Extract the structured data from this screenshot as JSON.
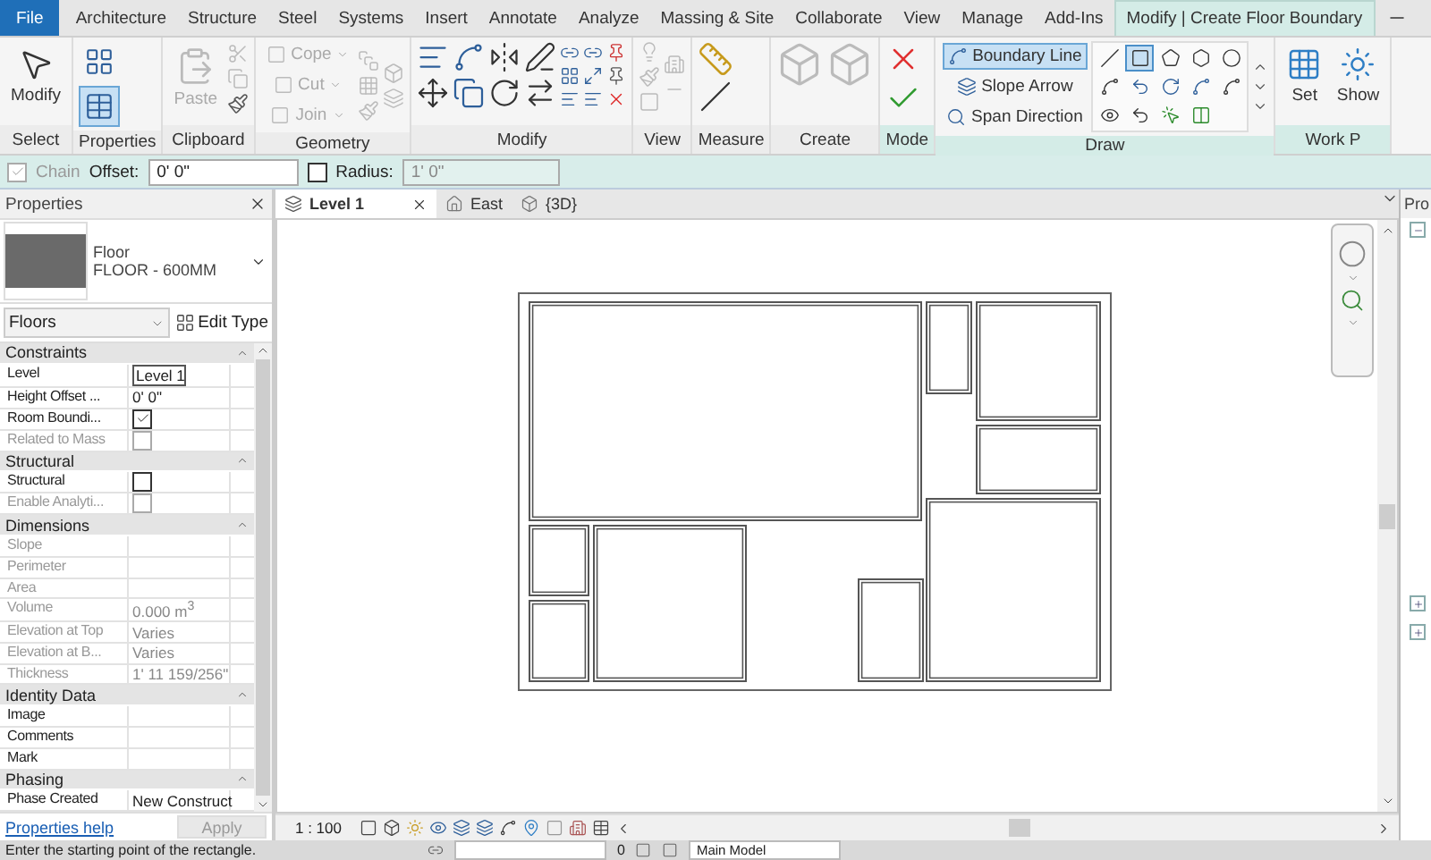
{
  "ribbon": {
    "tabs": [
      {
        "label": "File",
        "kind": "file",
        "selected": false
      },
      {
        "label": "Architecture",
        "kind": "tab",
        "selected": false
      },
      {
        "label": "Structure",
        "kind": "tab",
        "selected": false
      },
      {
        "label": "Steel",
        "kind": "tab",
        "selected": false
      },
      {
        "label": "Systems",
        "kind": "tab",
        "selected": false
      },
      {
        "label": "Insert",
        "kind": "tab",
        "selected": false
      },
      {
        "label": "Annotate",
        "kind": "tab",
        "selected": false
      },
      {
        "label": "Analyze",
        "kind": "tab",
        "selected": false
      },
      {
        "label": "Massing & Site",
        "kind": "tab",
        "selected": false
      },
      {
        "label": "Collaborate",
        "kind": "tab",
        "selected": false
      },
      {
        "label": "View",
        "kind": "tab",
        "selected": false
      },
      {
        "label": "Manage",
        "kind": "tab",
        "selected": false
      },
      {
        "label": "Add-Ins",
        "kind": "tab",
        "selected": false
      },
      {
        "label": "Modify | Create Floor Boundary",
        "kind": "context",
        "selected": true
      }
    ],
    "panels": [
      {
        "kind": "select",
        "label": "Select",
        "contextual": false,
        "tools": [
          {
            "label": "Modify",
            "disabled": false
          }
        ]
      },
      {
        "kind": "properties",
        "label": "Properties",
        "contextual": false,
        "tools": [
          {
            "selected": false
          },
          {
            "selected": true
          }
        ]
      },
      {
        "kind": "clipboard",
        "label": "Clipboard",
        "contextual": false,
        "tools": [
          {
            "label": "Paste",
            "disabled": true
          }
        ]
      },
      {
        "kind": "geometry",
        "label": "Geometry",
        "contextual": false,
        "tools": [
          {
            "label": "Cope",
            "disabled": true
          },
          {
            "label": "Cut",
            "disabled": true
          },
          {
            "label": "Join",
            "disabled": true
          }
        ]
      },
      {
        "kind": "modify",
        "label": "Modify",
        "contextual": false
      },
      {
        "kind": "view",
        "label": "View",
        "contextual": false
      },
      {
        "kind": "measure",
        "label": "Measure",
        "contextual": false
      },
      {
        "kind": "create",
        "label": "Create",
        "contextual": false
      },
      {
        "kind": "mode",
        "label": "Mode",
        "contextual": true
      },
      {
        "kind": "draw",
        "label": "Draw",
        "contextual": true,
        "tools": [
          {
            "label": "Boundary Line",
            "selected": true
          },
          {
            "label": "Slope Arrow",
            "selected": false
          },
          {
            "label": "Span Direction",
            "selected": false
          }
        ],
        "shapes": [
          {
            "kind": "line",
            "selected": false
          },
          {
            "kind": "rectangle",
            "selected": true
          },
          {
            "kind": "polygon",
            "selected": false
          },
          {
            "kind": "circumscribed",
            "selected": false
          },
          {
            "kind": "circle",
            "selected": false
          },
          {
            "kind": "arc3",
            "selected": false
          },
          {
            "kind": "arc",
            "selected": false
          },
          {
            "kind": "tangent",
            "selected": false
          },
          {
            "kind": "fillet",
            "selected": false
          },
          {
            "kind": "spline",
            "selected": false
          },
          {
            "kind": "ellipse",
            "selected": false
          },
          {
            "kind": "partial",
            "selected": false
          },
          {
            "kind": "pick",
            "selected": false
          },
          {
            "kind": "pickwall",
            "selected": false
          }
        ]
      },
      {
        "kind": "workplane",
        "label": "Work P",
        "contextual": true,
        "tools": [
          {
            "label": "Set",
            "disabled": false
          },
          {
            "label": "Show",
            "disabled": false
          }
        ]
      }
    ]
  },
  "options_bar": {
    "chain": {
      "label": "Chain",
      "checked": true,
      "disabled": true
    },
    "offset": {
      "label": "Offset:",
      "value": "0'  0\""
    },
    "radius": {
      "label": "Radius:",
      "checked": false,
      "disabled": true,
      "value": "1'  0\""
    }
  },
  "properties": {
    "title": "Properties",
    "type_family": "Floor",
    "type_name": "FLOOR - 600MM",
    "category": "Floors",
    "edit_type": "Edit Type",
    "sections": [
      {
        "title": "Constraints",
        "rows": [
          {
            "label": "Level",
            "kind": "field",
            "value": "Level 1",
            "disabled": false
          },
          {
            "label": "Height Offset ...",
            "kind": "text",
            "value": "0'  0\"",
            "disabled": false
          },
          {
            "label": "Room Boundi...",
            "kind": "checkbox",
            "checked": true,
            "disabled": false
          },
          {
            "label": "Related to Mass",
            "kind": "checkbox",
            "checked": false,
            "disabled": true
          }
        ]
      },
      {
        "title": "Structural",
        "rows": [
          {
            "label": "Structural",
            "kind": "checkbox",
            "checked": false,
            "disabled": false
          },
          {
            "label": "Enable Analyti...",
            "kind": "checkbox",
            "checked": false,
            "disabled": true
          }
        ]
      },
      {
        "title": "Dimensions",
        "rows": [
          {
            "label": "Slope",
            "kind": "text",
            "disabled": true
          },
          {
            "label": "Perimeter",
            "kind": "text",
            "disabled": true
          },
          {
            "label": "Area",
            "kind": "text",
            "disabled": true
          },
          {
            "label": "Volume",
            "kind": "text",
            "value": "0.000 m$^{3}$",
            "disabled": true
          },
          {
            "label": "Elevation at Top",
            "kind": "text",
            "value": "Varies",
            "disabled": true
          },
          {
            "label": "Elevation at B...",
            "kind": "text",
            "value": "Varies",
            "disabled": true
          },
          {
            "label": "Thickness",
            "kind": "text",
            "value": "1'  11 159/256\"",
            "disabled": true
          }
        ]
      },
      {
        "title": "Identity Data",
        "rows": [
          {
            "label": "Image",
            "kind": "text",
            "disabled": false
          },
          {
            "label": "Comments",
            "kind": "text",
            "disabled": false
          },
          {
            "label": "Mark",
            "kind": "text",
            "disabled": false
          }
        ]
      },
      {
        "title": "Phasing",
        "rows": [
          {
            "label": "Phase Created",
            "kind": "text",
            "value": "New Construct",
            "disabled": false
          }
        ]
      }
    ],
    "help_link": "Properties help",
    "apply": {
      "label": "Apply",
      "disabled": true
    }
  },
  "view_tabs": [
    {
      "label": "Level 1",
      "kind": "plan",
      "selected": true
    },
    {
      "label": "East",
      "kind": "elevation",
      "selected": false
    },
    {
      "label": "{3D}",
      "kind": "model",
      "selected": false
    }
  ],
  "view_control_bar": {
    "scale": "1 : 100"
  },
  "project_browser": {
    "title": "Pro"
  },
  "status_bar": {
    "message": "Enter the starting point of the rectangle.",
    "count": "0",
    "model": "Main Model"
  }
}
